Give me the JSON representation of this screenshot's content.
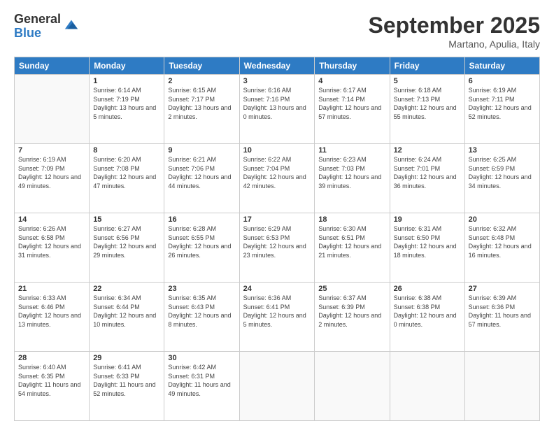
{
  "logo": {
    "general": "General",
    "blue": "Blue"
  },
  "header": {
    "month": "September 2025",
    "location": "Martano, Apulia, Italy"
  },
  "weekdays": [
    "Sunday",
    "Monday",
    "Tuesday",
    "Wednesday",
    "Thursday",
    "Friday",
    "Saturday"
  ],
  "weeks": [
    [
      {
        "day": "",
        "sunrise": "",
        "sunset": "",
        "daylight": ""
      },
      {
        "day": "1",
        "sunrise": "Sunrise: 6:14 AM",
        "sunset": "Sunset: 7:19 PM",
        "daylight": "Daylight: 13 hours and 5 minutes."
      },
      {
        "day": "2",
        "sunrise": "Sunrise: 6:15 AM",
        "sunset": "Sunset: 7:17 PM",
        "daylight": "Daylight: 13 hours and 2 minutes."
      },
      {
        "day": "3",
        "sunrise": "Sunrise: 6:16 AM",
        "sunset": "Sunset: 7:16 PM",
        "daylight": "Daylight: 13 hours and 0 minutes."
      },
      {
        "day": "4",
        "sunrise": "Sunrise: 6:17 AM",
        "sunset": "Sunset: 7:14 PM",
        "daylight": "Daylight: 12 hours and 57 minutes."
      },
      {
        "day": "5",
        "sunrise": "Sunrise: 6:18 AM",
        "sunset": "Sunset: 7:13 PM",
        "daylight": "Daylight: 12 hours and 55 minutes."
      },
      {
        "day": "6",
        "sunrise": "Sunrise: 6:19 AM",
        "sunset": "Sunset: 7:11 PM",
        "daylight": "Daylight: 12 hours and 52 minutes."
      }
    ],
    [
      {
        "day": "7",
        "sunrise": "Sunrise: 6:19 AM",
        "sunset": "Sunset: 7:09 PM",
        "daylight": "Daylight: 12 hours and 49 minutes."
      },
      {
        "day": "8",
        "sunrise": "Sunrise: 6:20 AM",
        "sunset": "Sunset: 7:08 PM",
        "daylight": "Daylight: 12 hours and 47 minutes."
      },
      {
        "day": "9",
        "sunrise": "Sunrise: 6:21 AM",
        "sunset": "Sunset: 7:06 PM",
        "daylight": "Daylight: 12 hours and 44 minutes."
      },
      {
        "day": "10",
        "sunrise": "Sunrise: 6:22 AM",
        "sunset": "Sunset: 7:04 PM",
        "daylight": "Daylight: 12 hours and 42 minutes."
      },
      {
        "day": "11",
        "sunrise": "Sunrise: 6:23 AM",
        "sunset": "Sunset: 7:03 PM",
        "daylight": "Daylight: 12 hours and 39 minutes."
      },
      {
        "day": "12",
        "sunrise": "Sunrise: 6:24 AM",
        "sunset": "Sunset: 7:01 PM",
        "daylight": "Daylight: 12 hours and 36 minutes."
      },
      {
        "day": "13",
        "sunrise": "Sunrise: 6:25 AM",
        "sunset": "Sunset: 6:59 PM",
        "daylight": "Daylight: 12 hours and 34 minutes."
      }
    ],
    [
      {
        "day": "14",
        "sunrise": "Sunrise: 6:26 AM",
        "sunset": "Sunset: 6:58 PM",
        "daylight": "Daylight: 12 hours and 31 minutes."
      },
      {
        "day": "15",
        "sunrise": "Sunrise: 6:27 AM",
        "sunset": "Sunset: 6:56 PM",
        "daylight": "Daylight: 12 hours and 29 minutes."
      },
      {
        "day": "16",
        "sunrise": "Sunrise: 6:28 AM",
        "sunset": "Sunset: 6:55 PM",
        "daylight": "Daylight: 12 hours and 26 minutes."
      },
      {
        "day": "17",
        "sunrise": "Sunrise: 6:29 AM",
        "sunset": "Sunset: 6:53 PM",
        "daylight": "Daylight: 12 hours and 23 minutes."
      },
      {
        "day": "18",
        "sunrise": "Sunrise: 6:30 AM",
        "sunset": "Sunset: 6:51 PM",
        "daylight": "Daylight: 12 hours and 21 minutes."
      },
      {
        "day": "19",
        "sunrise": "Sunrise: 6:31 AM",
        "sunset": "Sunset: 6:50 PM",
        "daylight": "Daylight: 12 hours and 18 minutes."
      },
      {
        "day": "20",
        "sunrise": "Sunrise: 6:32 AM",
        "sunset": "Sunset: 6:48 PM",
        "daylight": "Daylight: 12 hours and 16 minutes."
      }
    ],
    [
      {
        "day": "21",
        "sunrise": "Sunrise: 6:33 AM",
        "sunset": "Sunset: 6:46 PM",
        "daylight": "Daylight: 12 hours and 13 minutes."
      },
      {
        "day": "22",
        "sunrise": "Sunrise: 6:34 AM",
        "sunset": "Sunset: 6:44 PM",
        "daylight": "Daylight: 12 hours and 10 minutes."
      },
      {
        "day": "23",
        "sunrise": "Sunrise: 6:35 AM",
        "sunset": "Sunset: 6:43 PM",
        "daylight": "Daylight: 12 hours and 8 minutes."
      },
      {
        "day": "24",
        "sunrise": "Sunrise: 6:36 AM",
        "sunset": "Sunset: 6:41 PM",
        "daylight": "Daylight: 12 hours and 5 minutes."
      },
      {
        "day": "25",
        "sunrise": "Sunrise: 6:37 AM",
        "sunset": "Sunset: 6:39 PM",
        "daylight": "Daylight: 12 hours and 2 minutes."
      },
      {
        "day": "26",
        "sunrise": "Sunrise: 6:38 AM",
        "sunset": "Sunset: 6:38 PM",
        "daylight": "Daylight: 12 hours and 0 minutes."
      },
      {
        "day": "27",
        "sunrise": "Sunrise: 6:39 AM",
        "sunset": "Sunset: 6:36 PM",
        "daylight": "Daylight: 11 hours and 57 minutes."
      }
    ],
    [
      {
        "day": "28",
        "sunrise": "Sunrise: 6:40 AM",
        "sunset": "Sunset: 6:35 PM",
        "daylight": "Daylight: 11 hours and 54 minutes."
      },
      {
        "day": "29",
        "sunrise": "Sunrise: 6:41 AM",
        "sunset": "Sunset: 6:33 PM",
        "daylight": "Daylight: 11 hours and 52 minutes."
      },
      {
        "day": "30",
        "sunrise": "Sunrise: 6:42 AM",
        "sunset": "Sunset: 6:31 PM",
        "daylight": "Daylight: 11 hours and 49 minutes."
      },
      {
        "day": "",
        "sunrise": "",
        "sunset": "",
        "daylight": ""
      },
      {
        "day": "",
        "sunrise": "",
        "sunset": "",
        "daylight": ""
      },
      {
        "day": "",
        "sunrise": "",
        "sunset": "",
        "daylight": ""
      },
      {
        "day": "",
        "sunrise": "",
        "sunset": "",
        "daylight": ""
      }
    ]
  ]
}
